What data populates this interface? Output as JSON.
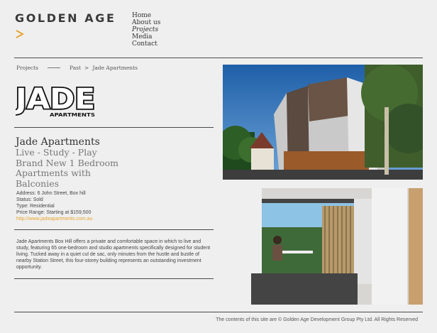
{
  "brand": {
    "name": "GOLDEN AGE",
    "accent": "#e8a530"
  },
  "nav": [
    "Home",
    "About us",
    "Projects",
    "Media",
    "Contact"
  ],
  "breadcrumb": {
    "first": "Projects",
    "second": "Past",
    "sep": ">",
    "current": "Jade Apartments"
  },
  "project_logo": {
    "big": "JADE",
    "small": "APARTMENTS"
  },
  "project": {
    "title": "Jade Apartments",
    "subtitle": "Live - Study - Play Brand New 1 Bedroom Apartments with Balconies",
    "address": "Address: 6 John Street, Box hill",
    "status": "Status: Sold",
    "type": "Type: Residential",
    "price": "Price Range: Starting at $159,500",
    "website": "http://www.jadeapartments.com.au",
    "description": "Jade Apartments Box Hill offers a private and comfortable space in which to live and study, featuring 65 one-bedroom and studio apartments specifically designed for student living. Tucked away in a quiet cul de sac, only minutes from the hustle and bustle of nearby Station Street, this four-storey building represents an outstanding investment opportunity."
  },
  "footer": "The contents of this site are © Golden Age Development Group Pty Ltd. All Rights Reserved"
}
